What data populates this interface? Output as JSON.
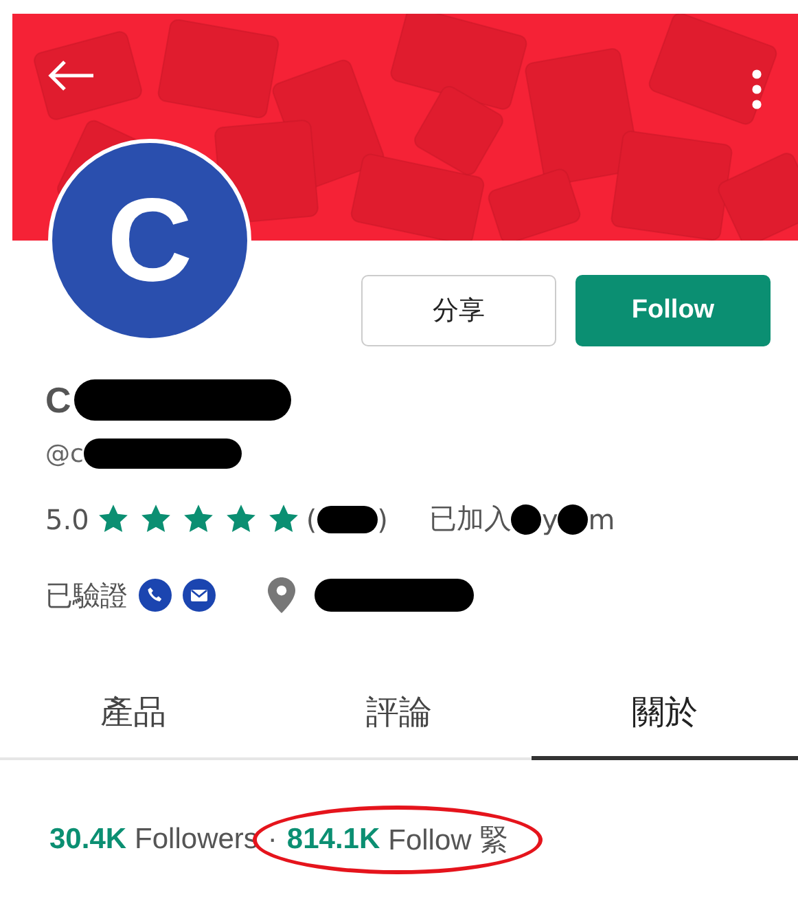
{
  "header": {
    "avatar_letter": "C"
  },
  "actions": [
    {
      "label": "分享",
      "kind": "outline"
    },
    {
      "label": "Follow",
      "kind": "primary"
    }
  ],
  "profile": {
    "name": "C",
    "handle": "@c",
    "rating": "5.0",
    "stars": 5,
    "review_open": "(",
    "review_close": ")",
    "joined_label": "已加入",
    "joined_parts": [
      "y",
      "m"
    ],
    "verified": "已驗證"
  },
  "tabs": [
    {
      "label": "產品",
      "selected": false
    },
    {
      "label": "評論",
      "selected": false
    },
    {
      "label": "關於",
      "selected": true
    }
  ],
  "stats": [
    {
      "count": "30.4K",
      "label": "Followers",
      "circled": false
    },
    {
      "count": "814.1K",
      "label": "Follow 緊",
      "circled": true
    }
  ],
  "separator": "·"
}
